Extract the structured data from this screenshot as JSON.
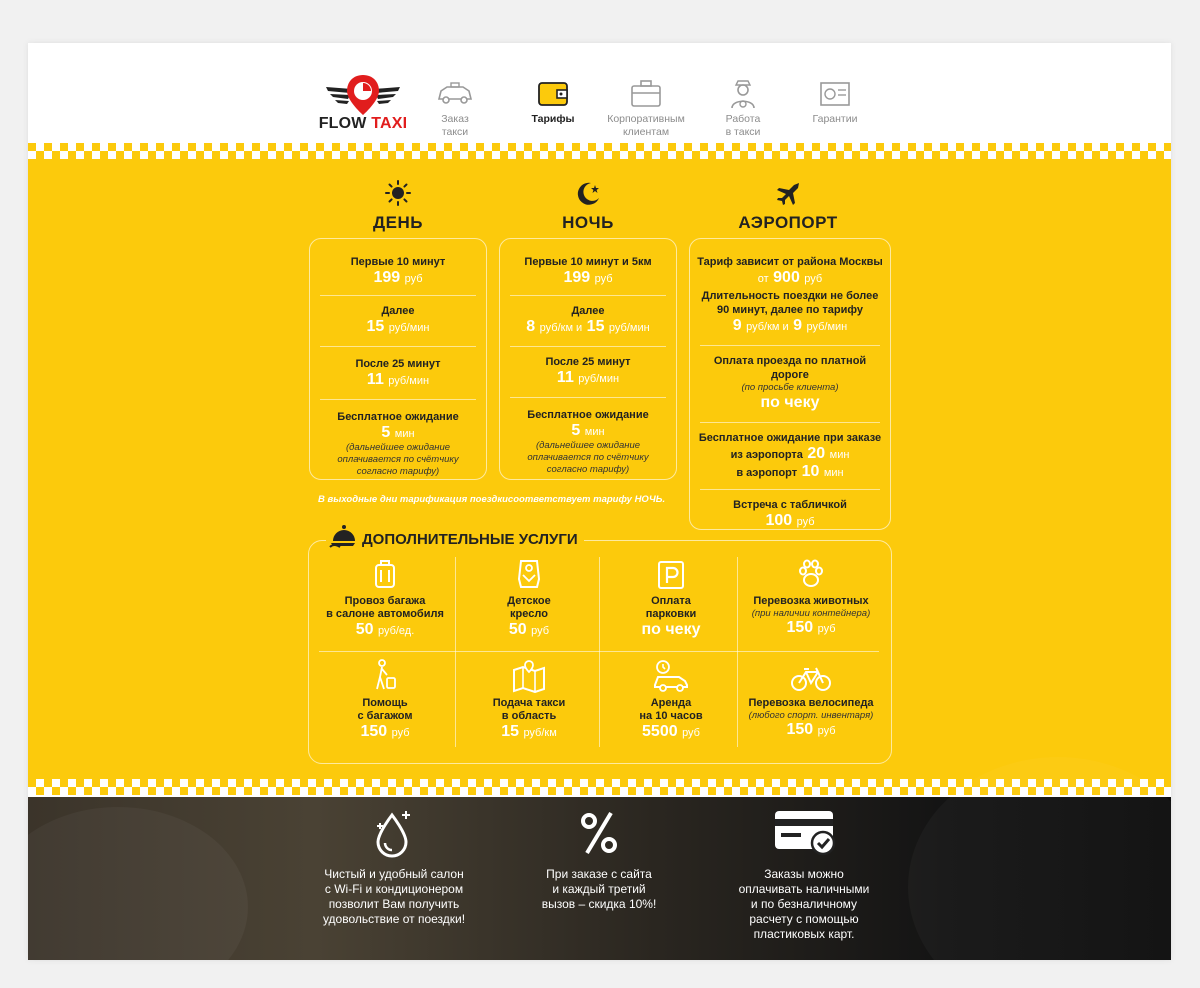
{
  "logo": {
    "word1": "FLOW",
    "word2": "TAXI"
  },
  "nav": [
    {
      "label": "Заказ\nтакси",
      "l1": "Заказ",
      "l2": "такси"
    },
    {
      "label": "Тарифы",
      "l1": "Тарифы",
      "l2": ""
    },
    {
      "label": "Корпоративным клиентам",
      "l1": "Корпоративным",
      "l2": "клиентам"
    },
    {
      "label": "Работа в такси",
      "l1": "Работа",
      "l2": "в такси"
    },
    {
      "label": "Гарантии",
      "l1": "Гарантии",
      "l2": ""
    }
  ],
  "tariffs": {
    "day": {
      "title": "ДЕНЬ",
      "r1_label": "Первые 10 минут",
      "r1_value": "199",
      "r1_unit": "руб",
      "r2_label": "Далее",
      "r2_value": "15",
      "r2_unit": "руб/мин",
      "r3_label": "После 25 минут",
      "r3_value": "11",
      "r3_unit": "руб/мин",
      "r4_label": "Бесплатное ожидание",
      "r4_value": "5",
      "r4_unit": "мин",
      "r4_note": "(дальнейшее ожидание оплачивается по счётчику согласно тарифу)"
    },
    "night": {
      "title": "НОЧЬ",
      "r1_label": "Первые 10 минут и 5км",
      "r1_value": "199",
      "r1_unit": "руб",
      "r2_label": "Далее",
      "r2_value_a": "8",
      "r2_unit_a": "руб/км и",
      "r2_value_b": "15",
      "r2_unit_b": "руб/мин",
      "r3_label": "После 25 минут",
      "r3_value": "11",
      "r3_unit": "руб/мин",
      "r4_label": "Бесплатное ожидание",
      "r4_value": "5",
      "r4_unit": "мин",
      "r4_note": "(дальнейшее ожидание оплачивается по счётчику согласно тарифу)"
    },
    "airport": {
      "title": "АЭРОПОРТ",
      "r1_label": "Тариф зависит от района Москвы",
      "r1_prefix": "от",
      "r1_value": "900",
      "r1_unit": "руб",
      "r2_label": "Длительность поездки не более 90 минут, далее по тарифу",
      "r2_value_a": "9",
      "r2_unit_a": "руб/км и",
      "r2_value_b": "9",
      "r2_unit_b": "руб/мин",
      "r3_label": "Оплата проезда по платной дороге",
      "r3_note": "(по просьбе клиента)",
      "r3_value": "по чеку",
      "r4_label": "Бесплатное ожидание при заказе",
      "r4_a_prefix": "из аэропорта",
      "r4_a_value": "20",
      "r4_a_unit": "мин",
      "r4_b_prefix": "в аэропорт",
      "r4_b_value": "10",
      "r4_b_unit": "мин",
      "r5_label": "Встреча с табличкой",
      "r5_value": "100",
      "r5_unit": "руб"
    },
    "weekend_note": "В выходные дни тарификация поездкисоответствует тарифу НОЧЬ."
  },
  "services": {
    "title": "ДОПОЛНИТЕЛЬНЫЕ УСЛУГИ",
    "items": [
      {
        "l1": "Провоз багажа",
        "l2": "в салоне автомобиля",
        "note": "",
        "value": "50",
        "unit": "руб/ед."
      },
      {
        "l1": "Детское",
        "l2": "кресло",
        "note": "",
        "value": "50",
        "unit": "руб"
      },
      {
        "l1": "Оплата",
        "l2": "парковки",
        "note": "",
        "value": "по чеку",
        "unit": ""
      },
      {
        "l1": "Перевозка животных",
        "l2": "",
        "note": "(при наличии контейнера)",
        "value": "150",
        "unit": "руб"
      },
      {
        "l1": "Помощь",
        "l2": "с багажом",
        "note": "",
        "value": "150",
        "unit": "руб"
      },
      {
        "l1": "Подача такси",
        "l2": "в область",
        "note": "",
        "value": "15",
        "unit": "руб/км"
      },
      {
        "l1": "Аренда",
        "l2": "на 10 часов",
        "note": "",
        "value": "5500",
        "unit": "руб"
      },
      {
        "l1": "Перевозка велосипеда",
        "l2": "",
        "note": "(любого спорт. инвентаря)",
        "value": "150",
        "unit": "руб"
      }
    ]
  },
  "features": [
    {
      "l1": "Чистый и удобный салон",
      "l2": "с Wi-Fi и кондиционером",
      "l3": "позволит Вам получить",
      "l4": "удовольствие от поездки!",
      "l5": ""
    },
    {
      "l1": "При заказе с сайта",
      "l2": "и каждый третий",
      "l3": "вызов – скидка 10%!",
      "l4": "",
      "l5": ""
    },
    {
      "l1": "Заказы можно",
      "l2": "оплачивать наличными",
      "l3": "и по безналичному",
      "l4": "расчету с помощью",
      "l5": "пластиковых карт."
    }
  ],
  "colors": {
    "accent": "#fcca0c",
    "logo_red": "#e11d1d",
    "text_dark": "#222222"
  }
}
